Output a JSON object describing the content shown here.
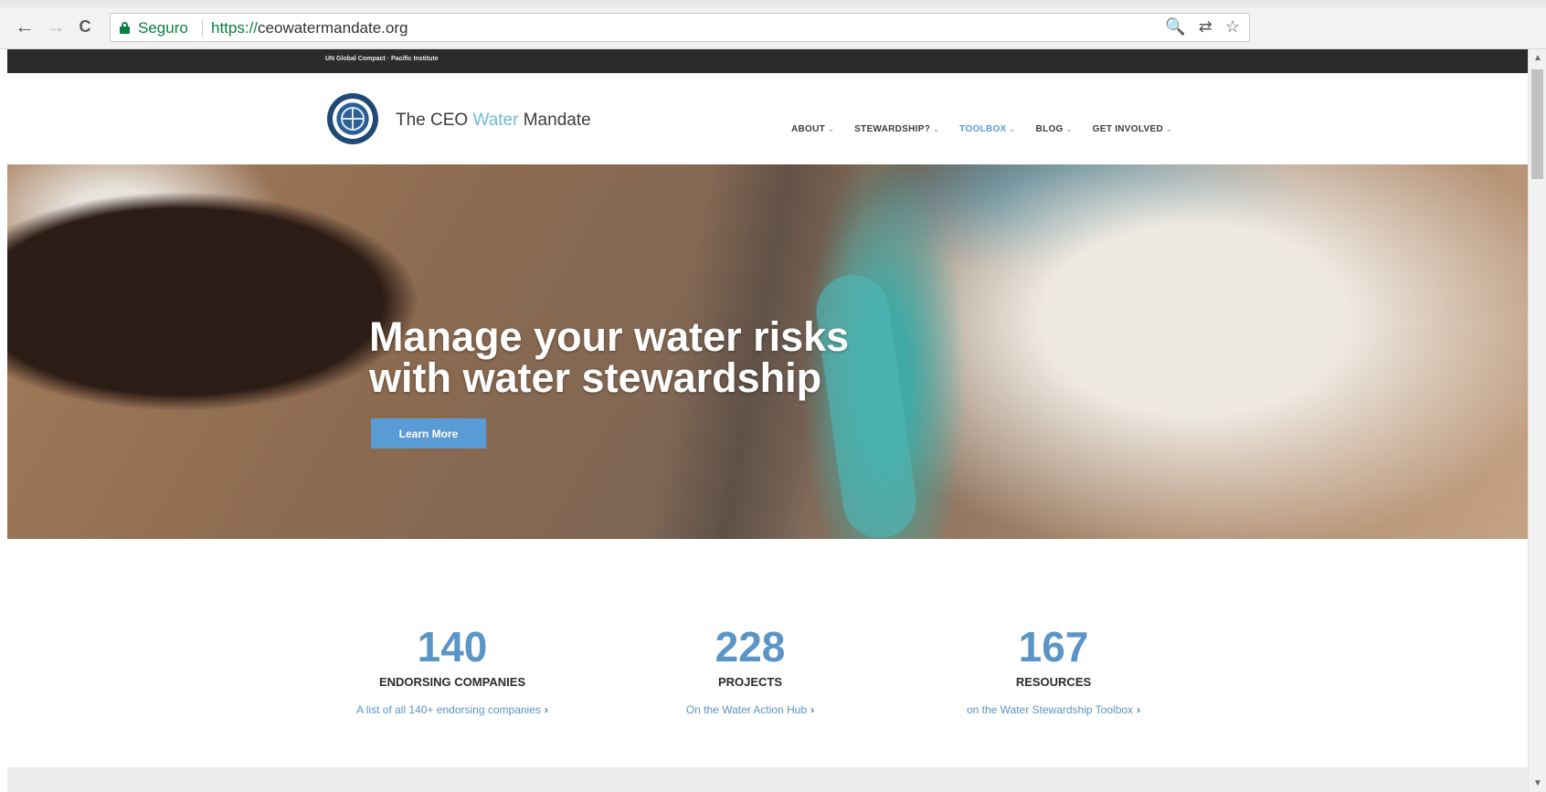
{
  "browser": {
    "nav": {
      "back": "←",
      "forward": "→",
      "reload": "C"
    },
    "secure_label": "Seguro",
    "url_scheme": "https://",
    "url_host": "ceowatermandate.org",
    "omni_icons": {
      "zoom": "🔍",
      "translate": "⇄",
      "bookmark": "☆"
    }
  },
  "topbar": {
    "text": "UN Global Compact · Pacific Institute"
  },
  "header": {
    "brand_pre": "The CEO ",
    "brand_water": "Water",
    "brand_post": " Mandate",
    "menu": [
      {
        "label": "ABOUT",
        "active": false
      },
      {
        "label": "STEWARDSHIP?",
        "active": false
      },
      {
        "label": "TOOLBOX",
        "active": true
      },
      {
        "label": "BLOG",
        "active": false
      },
      {
        "label": "GET INVOLVED",
        "active": false
      }
    ],
    "caret": "⌄"
  },
  "hero": {
    "headline_line1": "Manage your water risks",
    "headline_line2": "with water stewardship",
    "cta_label": "Learn More"
  },
  "stats": [
    {
      "number": "140",
      "label": "ENDORSING COMPANIES",
      "link": "A list of all 140+ endorsing companies"
    },
    {
      "number": "228",
      "label": "PROJECTS",
      "link": "On the Water Action Hub"
    },
    {
      "number": "167",
      "label": "RESOURCES",
      "link": "on the Water Stewardship Toolbox"
    }
  ],
  "colors": {
    "accent": "#5b94c6",
    "topbar": "#2b2b2b",
    "secure": "#0b8043"
  }
}
